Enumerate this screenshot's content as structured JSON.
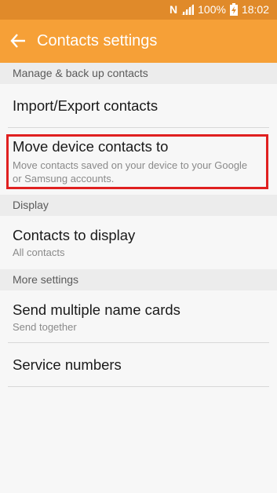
{
  "status_bar": {
    "nfc": "N",
    "battery_percent": "100%",
    "time": "18:02"
  },
  "app_bar": {
    "title": "Contacts settings"
  },
  "sections": {
    "manage": "Manage & back up contacts",
    "display": "Display",
    "more": "More settings"
  },
  "items": {
    "import_export": {
      "title": "Import/Export contacts"
    },
    "move_device": {
      "title": "Move device contacts to",
      "sub_line1": "Move contacts saved on your device to your Google",
      "sub_line2": "or Samsung accounts."
    },
    "contacts_display": {
      "title": "Contacts to display",
      "sub": "All contacts"
    },
    "name_cards": {
      "title": "Send multiple name cards",
      "sub": "Send together"
    },
    "service_numbers": {
      "title": "Service numbers"
    }
  },
  "colors": {
    "app_bar": "#f6a037",
    "status_bar": "#e08a2a",
    "highlight": "#e02020"
  }
}
